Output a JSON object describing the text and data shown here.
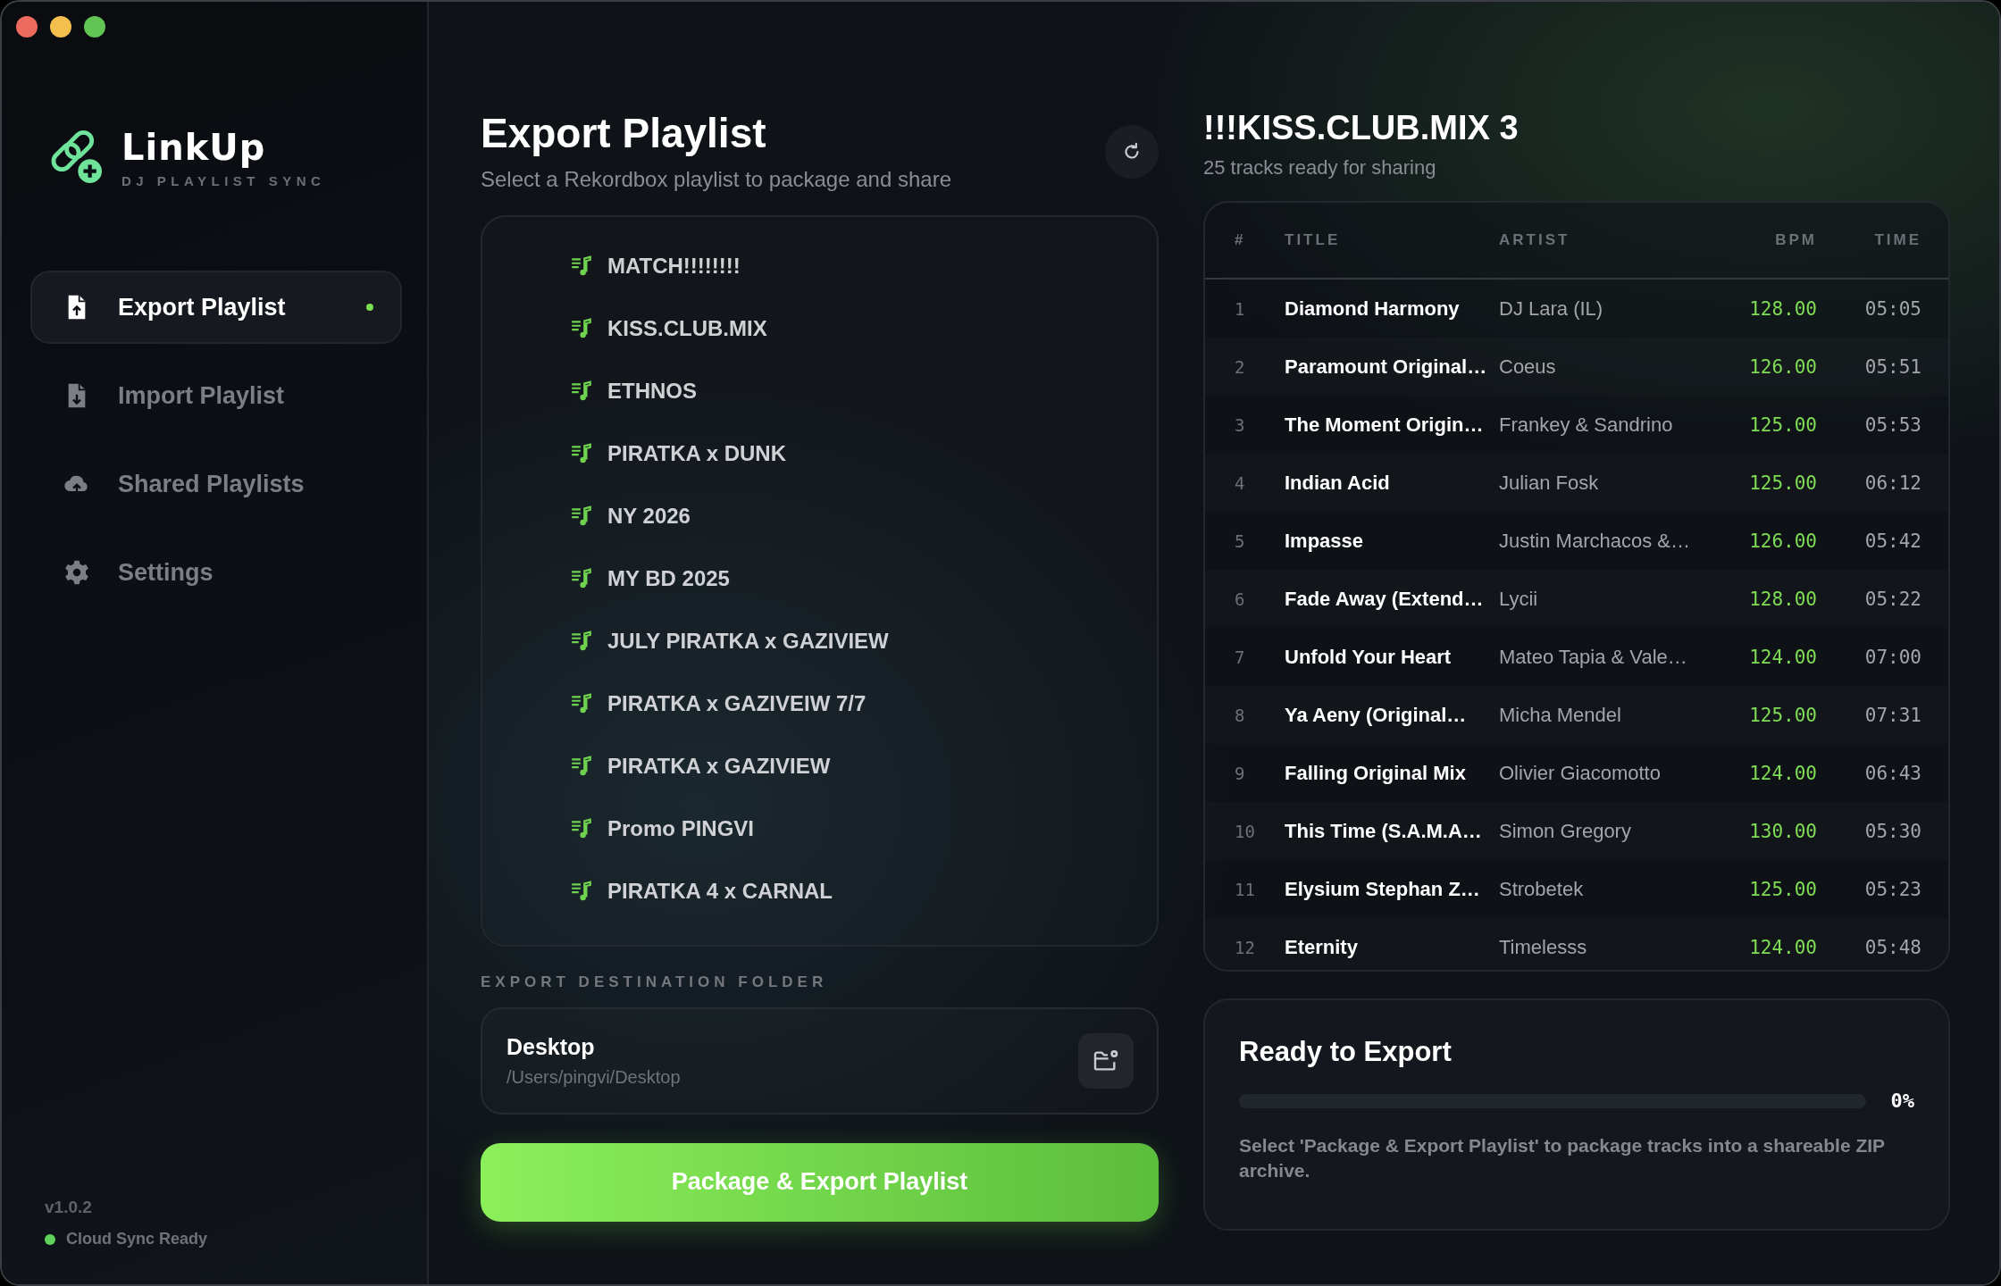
{
  "app": {
    "name": "LinkUp",
    "tagline": "DJ PLAYLIST SYNC"
  },
  "sidebar": {
    "items": [
      {
        "label": "Export Playlist",
        "kind": "export",
        "selected": true
      },
      {
        "label": "Import Playlist",
        "kind": "import",
        "selected": false
      },
      {
        "label": "Shared Playlists",
        "kind": "cloud",
        "selected": false
      },
      {
        "label": "Settings",
        "kind": "settings",
        "selected": false
      }
    ],
    "version": "v1.0.2",
    "status": {
      "text": "Cloud Sync Ready",
      "color": "#5fd35a"
    }
  },
  "export": {
    "title": "Export Playlist",
    "subtitle": "Select a Rekordbox playlist to package and share",
    "playlists": [
      "MATCH!!!!!!!!",
      "KISS.CLUB.MIX",
      "ETHNOS",
      "PIRATKA x DUNK",
      "NY 2026",
      "MY BD 2025",
      "JULY PIRATKA x GAZIVIEW",
      "PIRATKA x GAZIVEIW 7/7",
      "PIRATKA x GAZIVIEW",
      "Promo PINGVI",
      "PIRATKA 4 x CARNAL"
    ],
    "destination": {
      "label": "EXPORT DESTINATION FOLDER",
      "name": "Desktop",
      "path": "/Users/pingvi/Desktop"
    },
    "button": "Package & Export Playlist"
  },
  "tracks": {
    "title": "!!!KISS.CLUB.MIX 3",
    "subtitle": "25 tracks ready for sharing",
    "columns": [
      "#",
      "TITLE",
      "ARTIST",
      "BPM",
      "TIME"
    ],
    "rows": [
      {
        "number": "1",
        "title": "Diamond Harmony",
        "artist": "DJ Lara (IL)",
        "bpm": "128.00",
        "time": "05:05"
      },
      {
        "number": "2",
        "title": "Paramount Original…",
        "artist": "Coeus",
        "bpm": "126.00",
        "time": "05:51"
      },
      {
        "number": "3",
        "title": "The Moment Origin…",
        "artist": "Frankey & Sandrino",
        "bpm": "125.00",
        "time": "05:53"
      },
      {
        "number": "4",
        "title": "Indian Acid",
        "artist": "Julian Fosk",
        "bpm": "125.00",
        "time": "06:12"
      },
      {
        "number": "5",
        "title": "Impasse",
        "artist": "Justin Marchacos &…",
        "bpm": "126.00",
        "time": "05:42"
      },
      {
        "number": "6",
        "title": "Fade Away (Extend…",
        "artist": "Lycii",
        "bpm": "128.00",
        "time": "05:22"
      },
      {
        "number": "7",
        "title": "Unfold Your Heart",
        "artist": "Mateo Tapia & Vale…",
        "bpm": "124.00",
        "time": "07:00"
      },
      {
        "number": "8",
        "title": "Ya Aeny (Original…",
        "artist": "Micha Mendel",
        "bpm": "125.00",
        "time": "07:31"
      },
      {
        "number": "9",
        "title": "Falling Original Mix",
        "artist": "Olivier Giacomotto",
        "bpm": "124.00",
        "time": "06:43"
      },
      {
        "number": "10",
        "title": "This Time (S.A.M.A…",
        "artist": "Simon Gregory",
        "bpm": "130.00",
        "time": "05:30"
      },
      {
        "number": "11",
        "title": "Elysium Stephan Z…",
        "artist": "Strobetek",
        "bpm": "125.00",
        "time": "05:23"
      },
      {
        "number": "12",
        "title": "Eternity",
        "artist": "Timelesss",
        "bpm": "124.00",
        "time": "05:48"
      }
    ]
  },
  "progress": {
    "title": "Ready to Export",
    "level": 0,
    "reading": "0%",
    "message": "Select 'Package & Export Playlist' to package tracks into a shareable ZIP archive."
  }
}
